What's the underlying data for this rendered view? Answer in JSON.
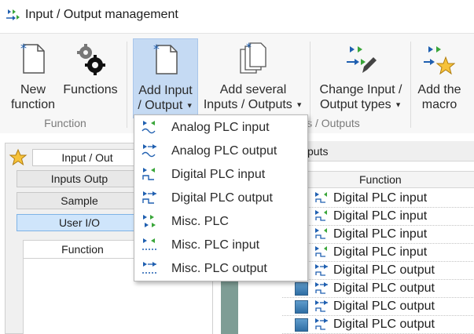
{
  "window": {
    "title": "Input / Output management"
  },
  "ribbon": {
    "new_function": {
      "line1": "New",
      "line2": "function"
    },
    "functions": {
      "line1": "Functions"
    },
    "add_io": {
      "line1": "Add Input",
      "line2": "/ Output"
    },
    "add_several": {
      "line1": "Add several",
      "line2": "Inputs / Outputs"
    },
    "change_types": {
      "line1": "Change Input /",
      "line2": "Output types"
    },
    "add_macro": {
      "line1": "Add the",
      "line2": "macro"
    },
    "groups": {
      "function": "Function",
      "io_partial": "ts / Outputs"
    }
  },
  "dropdown": {
    "items": [
      {
        "label": "Analog PLC input",
        "icon": "analog-input-icon"
      },
      {
        "label": "Analog PLC output",
        "icon": "analog-output-icon"
      },
      {
        "label": "Digital PLC input",
        "icon": "digital-input-icon"
      },
      {
        "label": "Digital PLC output",
        "icon": "digital-output-icon"
      },
      {
        "label": "Misc. PLC",
        "icon": "misc-plc-icon"
      },
      {
        "label": "Misc. PLC input",
        "icon": "misc-input-icon"
      },
      {
        "label": "Misc. PLC output",
        "icon": "misc-output-icon"
      }
    ]
  },
  "left_panel": {
    "row1": "Input / Out",
    "row2": "Inputs Outp",
    "row3": "Sample",
    "row4": "User I/O",
    "function_header": "Function"
  },
  "right_panel": {
    "title": "puts",
    "header_function": "Function",
    "rows": [
      {
        "type": "Digital PLC input"
      },
      {
        "type": "Digital PLC input"
      },
      {
        "type": "Digital PLC input"
      },
      {
        "type": "Digital PLC input"
      },
      {
        "type": "Digital PLC output"
      },
      {
        "type": "Digital PLC output"
      },
      {
        "type": "Digital PLC output"
      },
      {
        "type": "Digital PLC output"
      }
    ]
  },
  "colors": {
    "accent_green": "#3aa63a",
    "accent_blue": "#1f5fb0",
    "menu_selected": "#c5daf3"
  }
}
